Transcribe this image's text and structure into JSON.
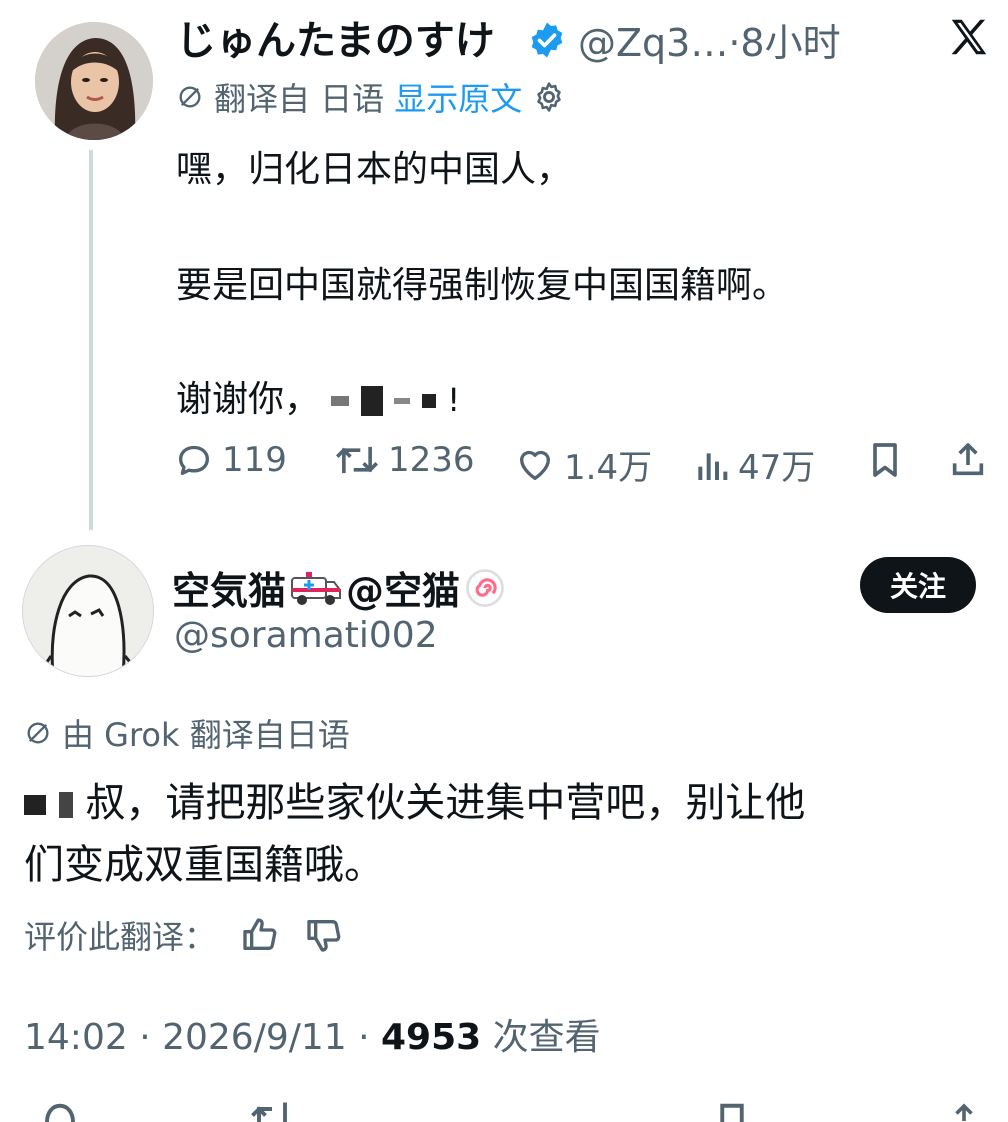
{
  "tweet": {
    "author_name": "じゅんたまのすけ",
    "handle_time": "@Zq3…·8小时",
    "translated_from": "翻译自 日语",
    "show_original": "显示原文",
    "lines": [
      "嘿，归化日本的中国人，",
      "要是回中国就得强制恢复中国国籍啊。",
      "谢谢你，"
    ],
    "stats": {
      "replies": "119",
      "retweets": "1236",
      "likes": "1.4万",
      "views": "47万"
    }
  },
  "reply": {
    "author_name": "空気猫",
    "author_suffix": "@空猫",
    "handle": "@soramati002",
    "follow_label": "关注",
    "grok_label": "由 Grok 翻译自日语",
    "line1": "叔，请把那些家伙关进集中营吧，别让他",
    "line2": "们变成双重国籍哦。",
    "rate_label": "评价此翻译：",
    "time": "14:02 · 2026/9/11 · ",
    "view_count": "4953",
    "view_suffix": " 次查看"
  },
  "colors": {
    "text": "#0f1419",
    "secondary": "#536471",
    "link": "#1d9bf0",
    "verified": "#1d9bf0"
  }
}
